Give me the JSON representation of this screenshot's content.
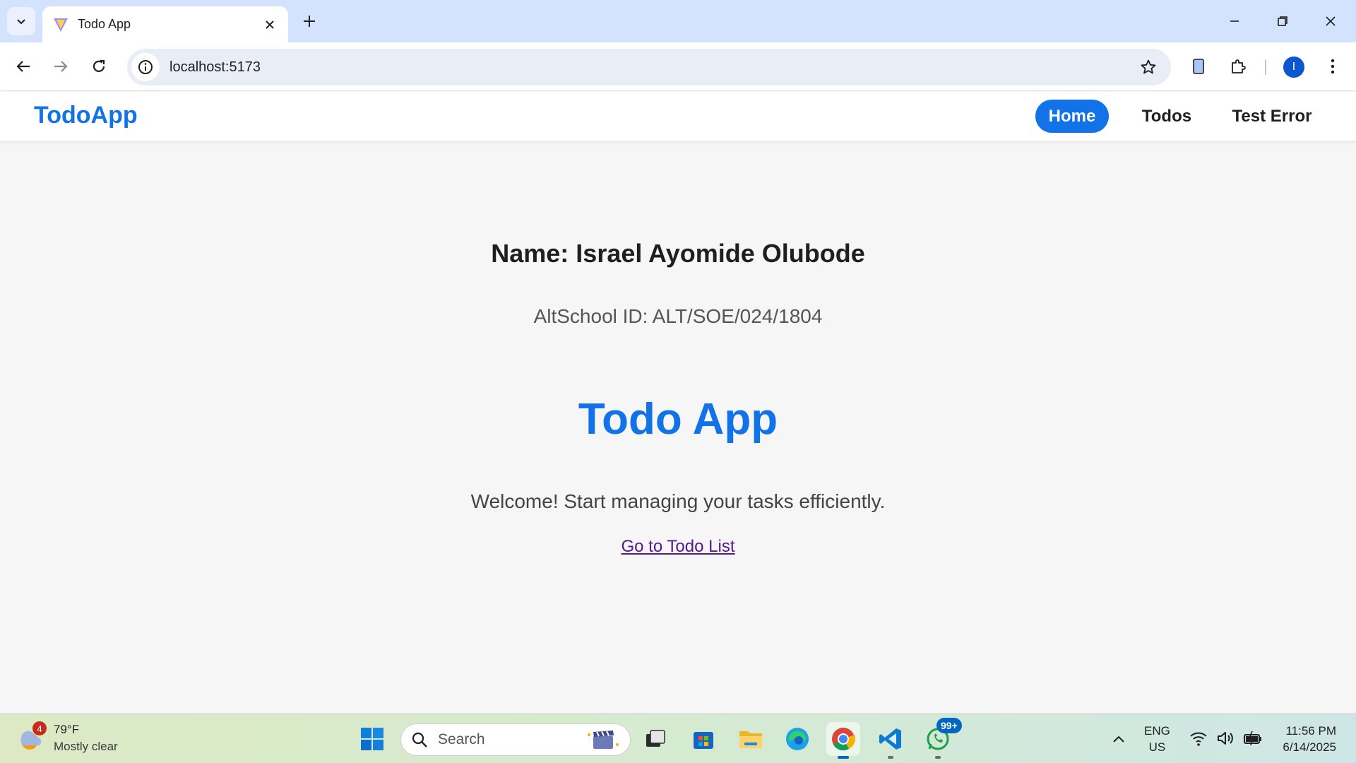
{
  "browser": {
    "tab_title": "Todo App",
    "url": "localhost:5173",
    "profile_initial": "I"
  },
  "navbar": {
    "brand": "TodoApp",
    "links": [
      {
        "label": "Home",
        "active": true
      },
      {
        "label": "Todos",
        "active": false
      },
      {
        "label": "Test Error",
        "active": false
      }
    ]
  },
  "main": {
    "name_line": "Name: Israel Ayomide Olubode",
    "id_line": "AltSchool ID: ALT/SOE/024/1804",
    "title": "Todo App",
    "welcome": "Welcome! Start managing your tasks efficiently.",
    "cta_link": "Go to Todo List"
  },
  "taskbar": {
    "weather_badge": "4",
    "weather_temp": "79°F",
    "weather_desc": "Mostly clear",
    "search_placeholder": "Search",
    "whatsapp_badge": "99+",
    "lang_line1": "ENG",
    "lang_line2": "US",
    "time": "11:56 PM",
    "date": "6/14/2025"
  },
  "colors": {
    "accent": "#1272e8",
    "visited_link": "#551a8b",
    "tabstrip": "#d3e3fd"
  }
}
